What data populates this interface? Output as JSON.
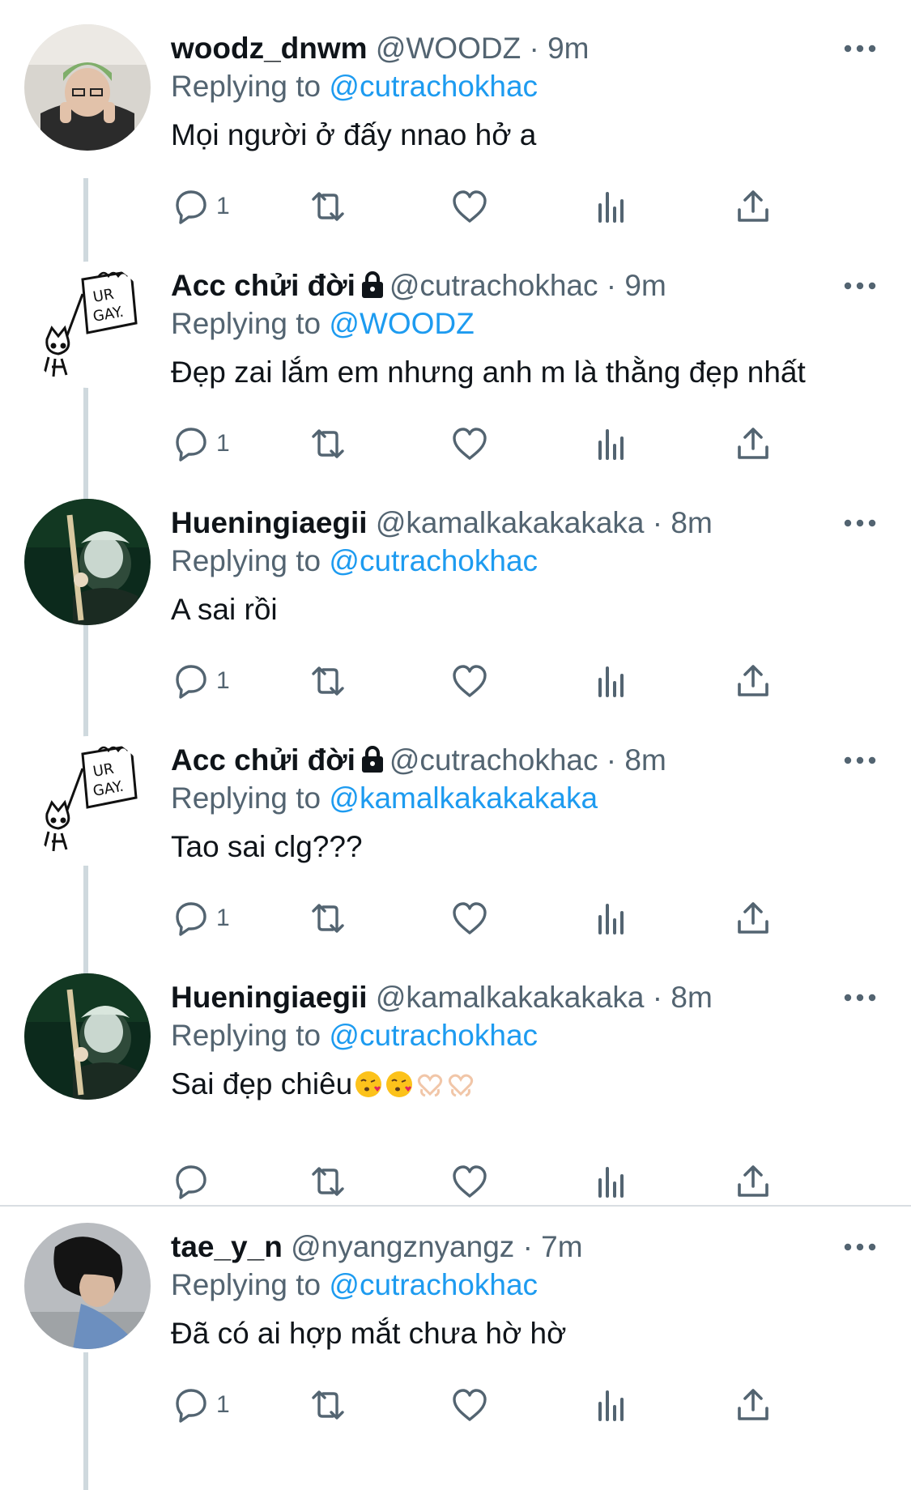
{
  "tweets": [
    {
      "name": "woodz_dnwm",
      "handle": "@WOODZ",
      "dot": "·",
      "time": "9m",
      "locked": false,
      "replying_prefix": "Replying to",
      "replying_to": "@cutrachokhac",
      "text": "Mọi người ở đấy nnao hở a",
      "reply_count": "1",
      "avatar": "photo-person-green-beanie"
    },
    {
      "name": "Acc chửi đời",
      "handle": "@cutrachokhac",
      "dot": "·",
      "time": "9m",
      "locked": true,
      "replying_prefix": "Replying to",
      "replying_to": "@WOODZ",
      "text": "Đẹp zai lắm em nhưng anh m là thằng đẹp nhất",
      "reply_count": "1",
      "avatar": "doodle-cat-ur-gay-sign"
    },
    {
      "name": "Hueningiaegii",
      "handle": "@kamalkakakakaka",
      "dot": "·",
      "time": "8m",
      "locked": false,
      "replying_prefix": "Replying to",
      "replying_to": "@cutrachokhac",
      "text": "A sai rồi",
      "reply_count": "1",
      "avatar": "photo-guitarist-green-stage"
    },
    {
      "name": "Acc chửi đời",
      "handle": "@cutrachokhac",
      "dot": "·",
      "time": "8m",
      "locked": true,
      "replying_prefix": "Replying to",
      "replying_to": "@kamalkakakakaka",
      "text": "Tao sai clg???",
      "reply_count": "1",
      "avatar": "doodle-cat-ur-gay-sign"
    },
    {
      "name": "Hueningiaegii",
      "handle": "@kamalkakakakaka",
      "dot": "·",
      "time": "8m",
      "locked": false,
      "replying_prefix": "Replying to",
      "replying_to": "@cutrachokhac",
      "text": "Sai đẹp chiêu",
      "emojis": [
        "kissing-face-icon",
        "kissing-face-icon",
        "heart-hands-icon",
        "heart-hands-icon"
      ],
      "reply_count": "",
      "avatar": "photo-guitarist-green-stage"
    },
    {
      "name": "tae_y_n",
      "handle": "@nyangznyangz",
      "dot": "·",
      "time": "7m",
      "locked": false,
      "replying_prefix": "Replying to",
      "replying_to": "@cutrachokhac",
      "text": "Đã có ai hợp mắt chưa hờ hờ",
      "reply_count": "1",
      "avatar": "photo-dark-hair-person"
    }
  ],
  "icons": {
    "reply": "reply-icon",
    "retweet": "retweet-icon",
    "like": "heart-icon",
    "views": "views-icon",
    "share": "share-icon",
    "more": "more-options-icon",
    "lock": "lock-icon"
  },
  "colors": {
    "link": "#1d9bf0",
    "secondary_text": "#536471",
    "primary_text": "#0f1419",
    "thread_line": "#cfd9de"
  }
}
